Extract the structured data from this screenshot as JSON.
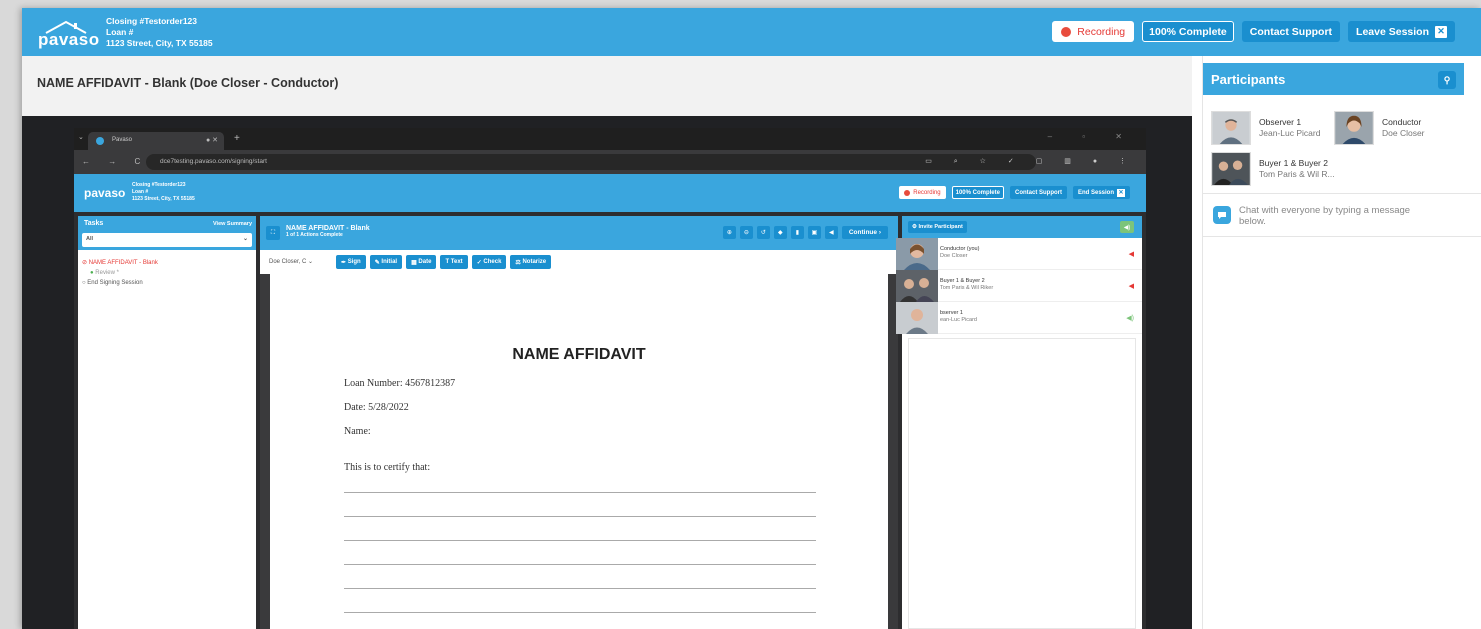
{
  "header": {
    "logo_text": "pavaso",
    "closing": "Closing #Testorder123",
    "loan": "Loan #",
    "address": "1123 Street, City, TX 55185",
    "recording_label": "Recording",
    "complete_label": "100% Complete",
    "support_label": "Contact Support",
    "leave_label": "Leave Session"
  },
  "document": {
    "title": "NAME AFFIDAVIT - Blank (Doe Closer - Conductor)"
  },
  "browser": {
    "tab_title": "Pavaso",
    "url": "dce7testing.pavaso.com/signing/start"
  },
  "inner": {
    "logo_text": "pavaso",
    "closing": "Closing #Testorder123",
    "loan": "Loan #",
    "address": "1123 Street, City, TX 55185",
    "recording_label": "Recording",
    "complete_label": "100% Complete",
    "support_label": "Contact Support",
    "end_label": "End Session",
    "tasks_title": "Tasks",
    "view_summary": "View Summary",
    "filter_value": "All",
    "task_1": "NAME AFFIDAVIT - Blank",
    "task_1_sub": "Review *",
    "task_2": "End Signing Session",
    "doc_title": "NAME AFFIDAVIT - Blank",
    "doc_sub": "1 of 1 Actions Complete",
    "continue_label": "Continue",
    "signer": "Doe Closer, C",
    "fields": {
      "sign": "Sign",
      "initial": "Initial",
      "date": "Date",
      "text": "Text",
      "check": "Check",
      "notarize": "Notarize"
    },
    "page": {
      "heading": "NAME AFFIDAVIT",
      "loan_number": "Loan Number: 4567812387",
      "date": "Date: 5/28/2022",
      "name": "Name:",
      "certify": "This is to certify that:"
    },
    "invite_label": "Invite Participant",
    "participants": [
      {
        "name": "Conductor (you)",
        "sub": "Doe Closer"
      },
      {
        "name": "Buyer 1 & Buyer 2",
        "sub": "Tom Paris & Wil Riker"
      },
      {
        "name": "bserver 1",
        "sub": "ean-Luc Picard"
      }
    ]
  },
  "sidebar": {
    "title": "Participants",
    "participants": [
      {
        "name": "Observer 1",
        "sub": "Jean-Luc Picard"
      },
      {
        "name": "Conductor",
        "sub": "Doe Closer"
      },
      {
        "name": "Buyer 1 & Buyer 2",
        "sub": "Tom Paris & Wil R..."
      }
    ],
    "chat_placeholder": "Chat with everyone by typing a message below."
  },
  "colors": {
    "brand": "#3aa6de",
    "brand_dark": "#1a8fcf",
    "record": "#e84c3d"
  }
}
